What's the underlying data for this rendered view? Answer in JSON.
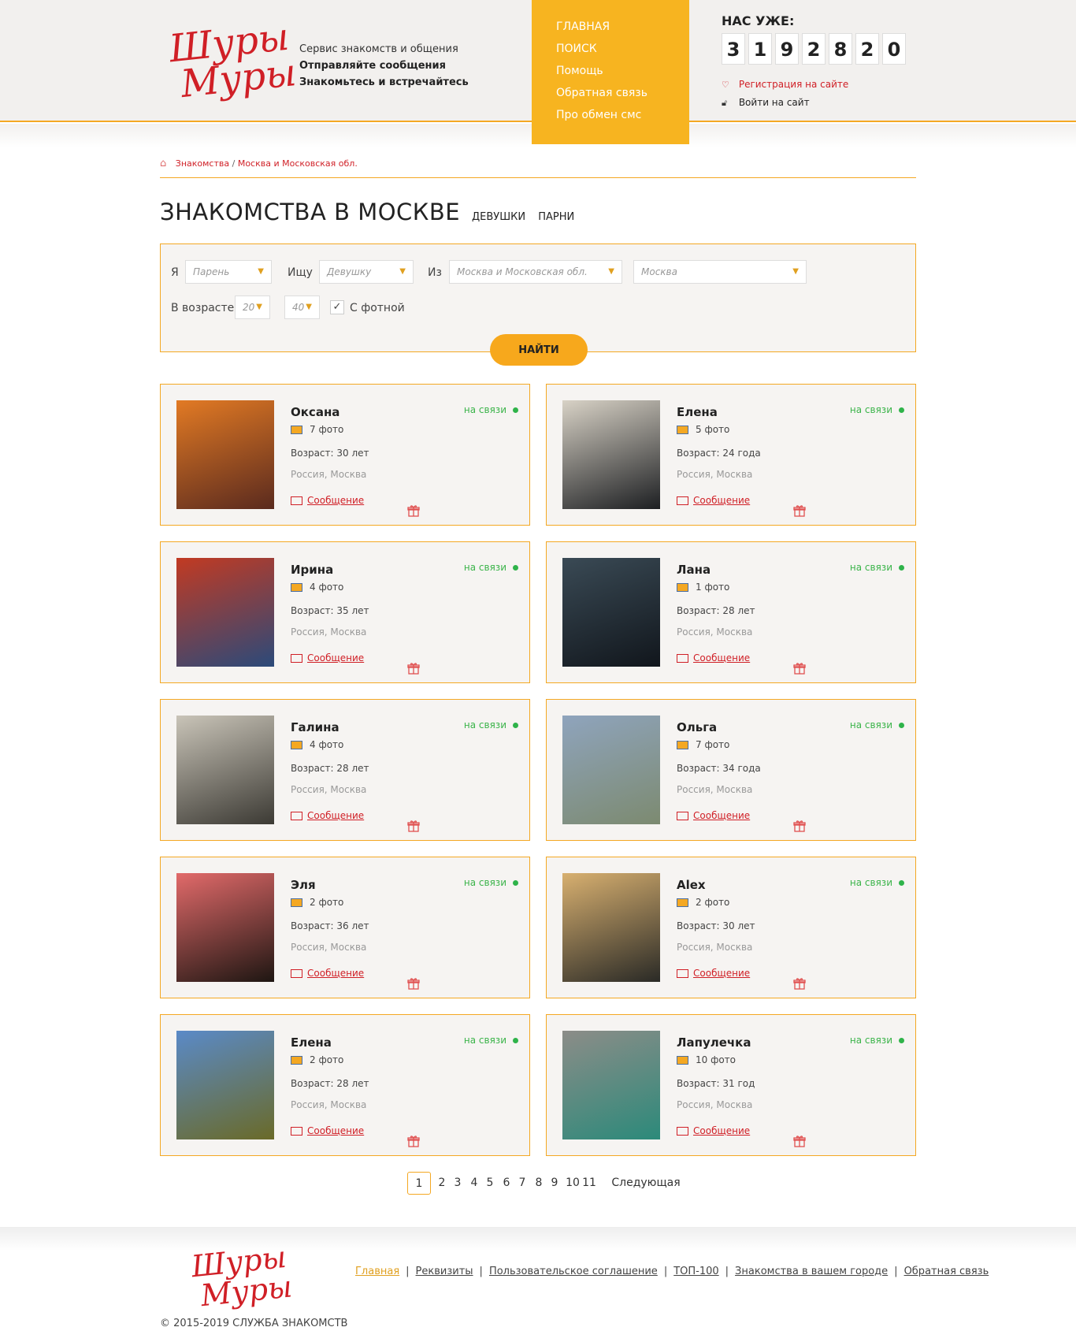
{
  "header": {
    "logo_line1": "Шуры",
    "logo_line2": "Муры",
    "tagline": "Сервис знакомств и общения",
    "tagline_bold1": "Отправляйте сообщения",
    "tagline_bold2": "Знакомьтесь и встречайтесь",
    "nav": [
      "ГЛАВНАЯ",
      "ПОИСК",
      "Помощь",
      "Обратная связь",
      "Про обмен смс"
    ],
    "counter_title": "НАС УЖЕ:",
    "counter_digits": [
      "3",
      "1",
      "9",
      "2",
      "8",
      "2",
      "0"
    ],
    "register_link": "Регистрация на сайте",
    "login_link": "Войти на сайт"
  },
  "breadcrumb": {
    "item1": "Знакомства",
    "separator": "/",
    "item2": "Москва и Московская обл."
  },
  "page_title": "ЗНАКОМСТВА В МОСКВЕ",
  "gender_tabs": [
    "ДЕВУШКИ",
    "ПАРНИ"
  ],
  "search": {
    "label_i": "Я",
    "i_value": "Парень",
    "label_seek": "Ищу",
    "seek_value": "Девушку",
    "label_from": "Из",
    "region_value": "Москва и Московская обл.",
    "city_value": "Москва",
    "label_age": "В возрасте",
    "age_from": "20",
    "age_to": "40",
    "with_photo_label": "С фотной",
    "with_photo_checked": true,
    "find_button": "НАЙТИ"
  },
  "profiles": [
    {
      "name": "Оксана",
      "status": "на связи",
      "photos": "7 фото",
      "age": "Возраст: 30 лет",
      "location": "Россия, Москва",
      "message": "Сообщение",
      "photo_colors": [
        "#e27a24",
        "#5a2a1e"
      ]
    },
    {
      "name": "Елена",
      "status": "на связи",
      "photos": "5 фото",
      "age": "Возраст: 24 года",
      "location": "Россия, Москва",
      "message": "Сообщение",
      "photo_colors": [
        "#d8d2c6",
        "#1d1f22"
      ]
    },
    {
      "name": "Ирина",
      "status": "на связи",
      "photos": "4 фото",
      "age": "Возраст: 35 лет",
      "location": "Россия, Москва",
      "message": "Сообщение",
      "photo_colors": [
        "#c23a22",
        "#2b4a7a"
      ]
    },
    {
      "name": "Лана",
      "status": "на связи",
      "photos": "1 фото",
      "age": "Возраст: 28 лет",
      "location": "Россия, Москва",
      "message": "Сообщение",
      "photo_colors": [
        "#3a4a55",
        "#11161c"
      ]
    },
    {
      "name": "Галина",
      "status": "на связи",
      "photos": "4 фото",
      "age": "Возраст: 28 лет",
      "location": "Россия, Москва",
      "message": "Сообщение",
      "photo_colors": [
        "#c9c4b8",
        "#3c3a34"
      ]
    },
    {
      "name": "Ольга",
      "status": "на связи",
      "photos": "7 фото",
      "age": "Возраст: 34 года",
      "location": "Россия, Москва",
      "message": "Сообщение",
      "photo_colors": [
        "#8fa4bd",
        "#7c8a70"
      ]
    },
    {
      "name": "Эля",
      "status": "на связи",
      "photos": "2 фото",
      "age": "Возраст: 36 лет",
      "location": "Россия, Москва",
      "message": "Сообщение",
      "photo_colors": [
        "#e26a6a",
        "#1e1612"
      ]
    },
    {
      "name": "Alex",
      "status": "на связи",
      "photos": "2 фото",
      "age": "Возраст: 30 лет",
      "location": "Россия, Москва",
      "message": "Сообщение",
      "photo_colors": [
        "#d8b070",
        "#2a2a26"
      ]
    },
    {
      "name": "Елена",
      "status": "на связи",
      "photos": "2 фото",
      "age": "Возраст: 28 лет",
      "location": "Россия, Москва",
      "message": "Сообщение",
      "photo_colors": [
        "#5a8ac8",
        "#6a6a28"
      ]
    },
    {
      "name": "Лапулечка",
      "status": "на связи",
      "photos": "10 фото",
      "age": "Возраст: 31 год",
      "location": "Россия, Москва",
      "message": "Сообщение",
      "photo_colors": [
        "#8c8c88",
        "#2c8a7a"
      ]
    }
  ],
  "pagination": {
    "pages": [
      "1",
      "2",
      "3",
      "4",
      "5",
      "6",
      "7",
      "8",
      "9",
      "10",
      "11"
    ],
    "current": "1",
    "next": "Следующая"
  },
  "footer": {
    "logo_line1": "Шуры",
    "logo_line2": "Муры",
    "links": [
      "Главная",
      "Реквизиты",
      "Пользовательское соглашение",
      "ТОП-100",
      "Знакомства в вашем городе",
      "Обратная связь"
    ],
    "copyright": "© 2015-2019 СЛУЖБА ЗНАКОМСТВ"
  },
  "colors": {
    "accent": "#f7b420",
    "brand_red": "#d01f26",
    "online_green": "#2fb34a"
  }
}
